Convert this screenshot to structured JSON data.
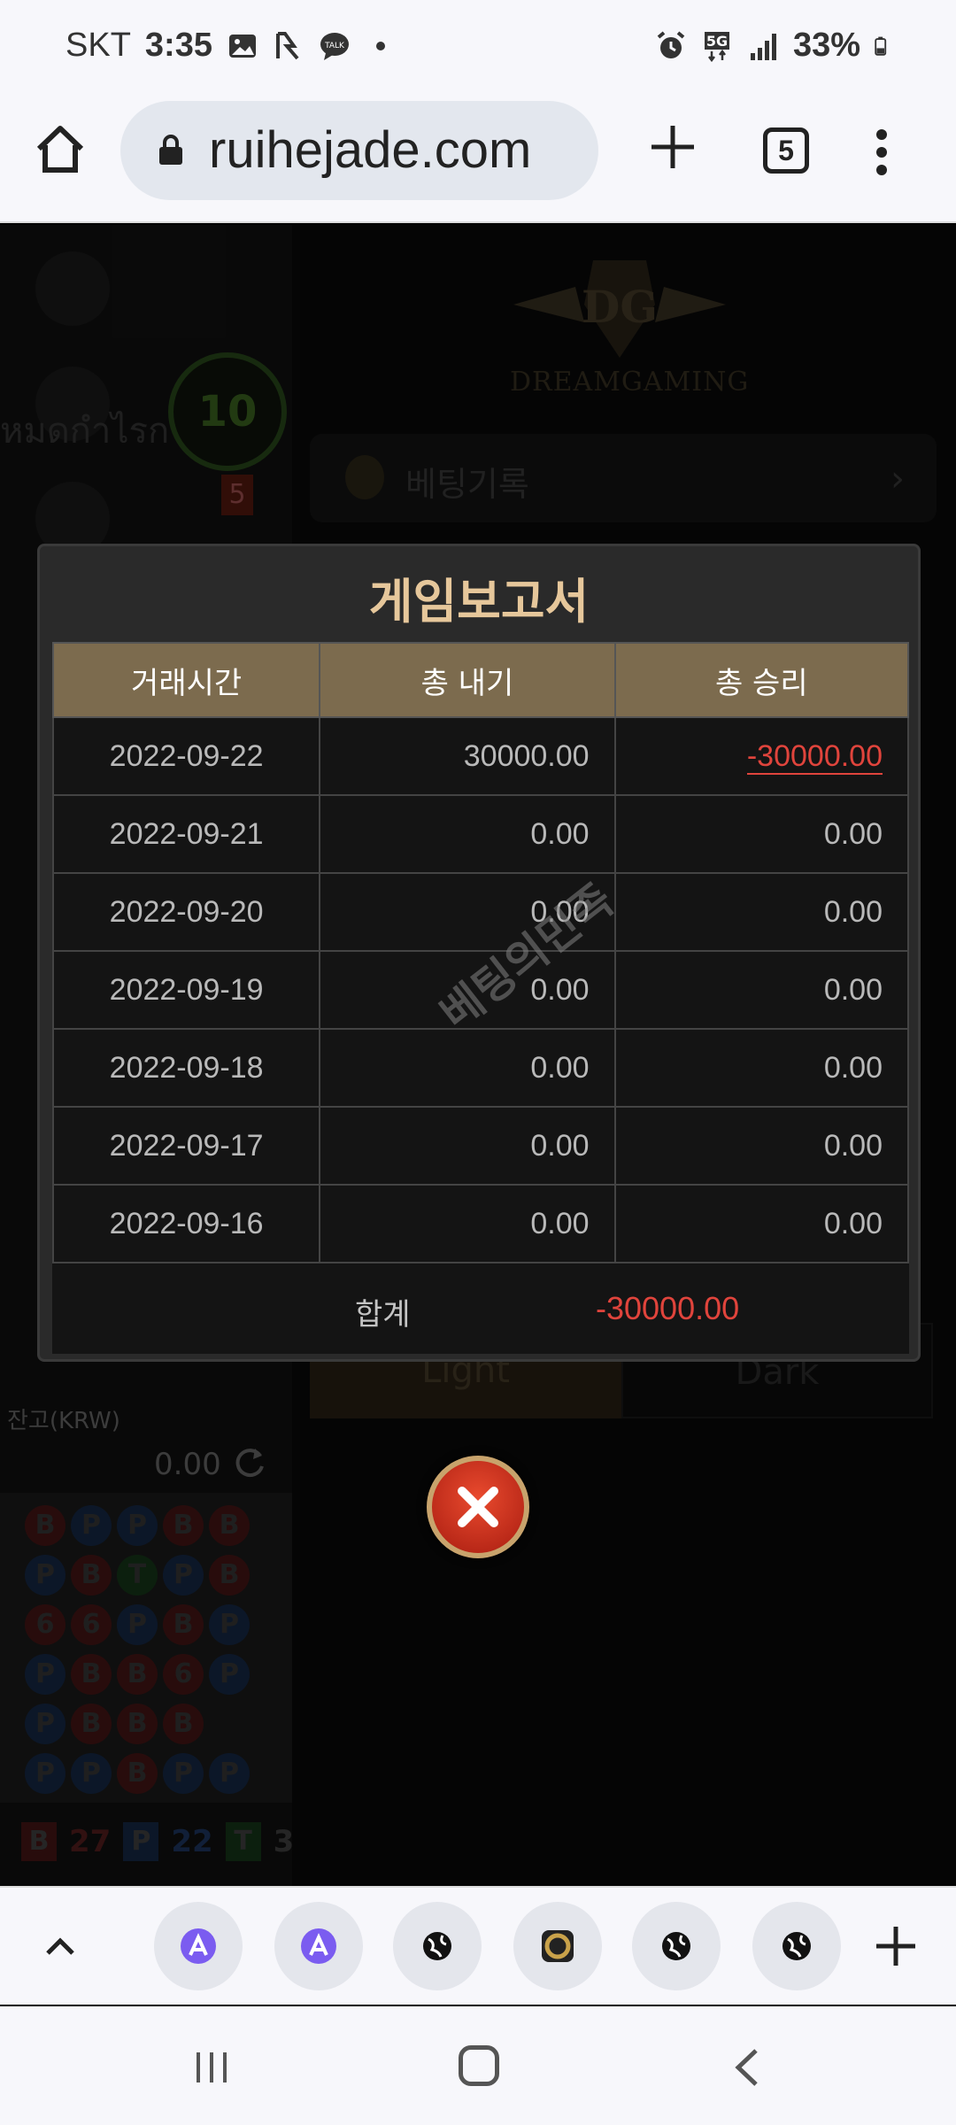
{
  "status_bar": {
    "carrier": "SKT",
    "time": "3:35",
    "battery": "33%",
    "network": "5G"
  },
  "browser": {
    "url": "ruihejade.com",
    "tab_count": "5"
  },
  "background": {
    "thai_text": "หมดกำไรก",
    "timer_value": "10",
    "brand": "DREAMGAMING",
    "bet_record_label": "베팅기록",
    "balance_label": "잔고(KRW)",
    "balance_value": "0.00",
    "light_tab": "Light",
    "dark_tab": "Dark",
    "road_counts": [
      {
        "label": "B",
        "count": "27"
      },
      {
        "label": "P",
        "count": "22"
      },
      {
        "label": "T",
        "count": "3"
      }
    ]
  },
  "report": {
    "title": "게임보고서",
    "columns": [
      "거래시간",
      "총 내기",
      "총 승리"
    ],
    "rows": [
      {
        "date": "2022-09-22",
        "bet": "30000.00",
        "win": "-30000.00"
      },
      {
        "date": "2022-09-21",
        "bet": "0.00",
        "win": "0.00"
      },
      {
        "date": "2022-09-20",
        "bet": "0.00",
        "win": "0.00"
      },
      {
        "date": "2022-09-19",
        "bet": "0.00",
        "win": "0.00"
      },
      {
        "date": "2022-09-18",
        "bet": "0.00",
        "win": "0.00"
      },
      {
        "date": "2022-09-17",
        "bet": "0.00",
        "win": "0.00"
      },
      {
        "date": "2022-09-16",
        "bet": "0.00",
        "win": "0.00"
      }
    ],
    "total_label": "합계",
    "total_value": "-30000.00"
  },
  "watermark": "베팅의민족",
  "colors": {
    "accent_gold": "#7c6b4e",
    "title_gold": "#e6c79b",
    "negative_red": "#e0443c"
  },
  "bottom_tabs": [
    "app-a-icon",
    "app-a-icon",
    "globe-icon",
    "dragon-icon",
    "globe-icon",
    "globe-icon"
  ]
}
